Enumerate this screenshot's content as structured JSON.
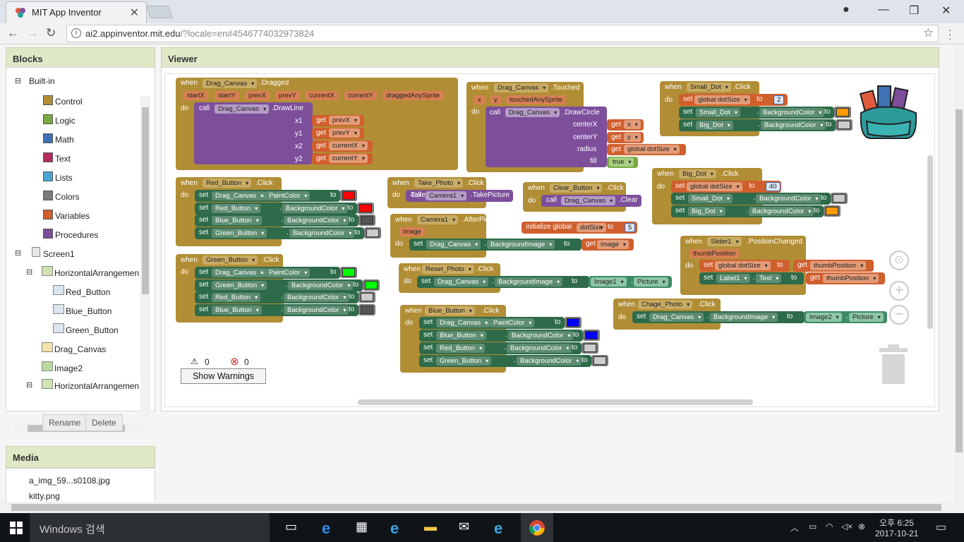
{
  "browser": {
    "tab_title": "MIT App Inventor",
    "tab_close": "✕",
    "url_host": "ai2.appinventor.mit.edu",
    "url_rest": "/?locale=en#4546774032973824",
    "window_minimize": "—",
    "window_restore": "❐",
    "window_close": "✕"
  },
  "blocks_panel": {
    "title": "Blocks",
    "builtin_label": "Built-in",
    "builtin": [
      {
        "label": "Control",
        "color": "#b18e35"
      },
      {
        "label": "Logic",
        "color": "#77ab41"
      },
      {
        "label": "Math",
        "color": "#3f71b5"
      },
      {
        "label": "Text",
        "color": "#b32d5e"
      },
      {
        "label": "Lists",
        "color": "#49a6d4"
      },
      {
        "label": "Colors",
        "color": "#7a7a7a"
      },
      {
        "label": "Variables",
        "color": "#d05f2e"
      },
      {
        "label": "Procedures",
        "color": "#7d4f9b"
      }
    ],
    "screen": "Screen1",
    "components": [
      "HorizontalArrangemen",
      "Red_Button",
      "Blue_Button",
      "Green_Button",
      "Drag_Canvas",
      "Image2",
      "HorizontalArrangemen"
    ],
    "rename": "Rename",
    "delete": "Delete"
  },
  "media_panel": {
    "title": "Media",
    "files": [
      "a_img_59...s0108.jpg",
      "kitty.png"
    ]
  },
  "viewer": {
    "title": "Viewer",
    "warnings_count": "0",
    "errors_count": "0",
    "show_warnings": "Show Warnings"
  },
  "blocks": {
    "when": "when",
    "do": "do",
    "set": "set",
    "get": "get",
    "to": "to",
    "call": "call",
    "dot": ".",
    "dragged": {
      "component": "Drag_Canvas",
      "event": ".Dragged",
      "params": [
        "startX",
        "startY",
        "prevX",
        "prevY",
        "currentX",
        "currentY",
        "draggedAnySprite"
      ],
      "method": ".DrawLine",
      "arg_labels": [
        "x1",
        "y1",
        "x2",
        "y2"
      ],
      "arg_values": [
        "prevX",
        "prevY",
        "currentX",
        "currentY"
      ]
    },
    "touched": {
      "component": "Drag_Canvas",
      "event": ".Touched",
      "params": [
        "x",
        "y",
        "touchedAnySprite"
      ],
      "method": ".DrawCircle",
      "arg_labels": [
        "centerX",
        "centerY",
        "radius",
        "fill"
      ],
      "arg_values": [
        "x",
        "y",
        "global dotSize",
        "true"
      ]
    },
    "small_dot": {
      "component": "Small_Dot",
      "event": ".Click",
      "var": "global dotSize",
      "value": "2",
      "rows": [
        {
          "comp": "Small_Dot",
          "prop": "BackgroundColor",
          "color": "#ff9900"
        },
        {
          "comp": "Big_Dot",
          "prop": "BackgroundColor",
          "color": "#cccccc"
        }
      ]
    },
    "big_dot": {
      "component": "Big_Dot",
      "event": ".Click",
      "var": "global dotSize",
      "value": "40",
      "rows": [
        {
          "comp": "Small_Dot",
          "prop": "BackgroundColor",
          "color": "#cccccc"
        },
        {
          "comp": "Big_Dot",
          "prop": "BackgroundColor",
          "color": "#ff9900"
        }
      ]
    },
    "red_button": {
      "component": "Red_Button",
      "event": ".Click",
      "rows": [
        {
          "comp": "Drag_Canvas",
          "prop": "PaintColor",
          "color": "#ff0000"
        },
        {
          "comp": "Red_Button",
          "prop": "BackgroundColor",
          "color": "#ff0000"
        },
        {
          "comp": "Blue_Button",
          "prop": "BackgroundColor",
          "color": "#555555"
        },
        {
          "comp": "Green_Button",
          "prop": "BackgroundColor",
          "color": "#cccccc"
        }
      ]
    },
    "green_button": {
      "component": "Green_Button",
      "event": ".Click",
      "rows": [
        {
          "comp": "Drag_Canvas",
          "prop": "PaintColor",
          "color": "#00ff00"
        },
        {
          "comp": "Green_Button",
          "prop": "BackgroundColor",
          "color": "#00ff00"
        },
        {
          "comp": "Red_Button",
          "prop": "BackgroundColor",
          "color": "#cccccc"
        },
        {
          "comp": "Blue_Button",
          "prop": "BackgroundColor",
          "color": "#555555"
        }
      ]
    },
    "blue_button": {
      "component": "Blue_Button",
      "event": ".Click",
      "rows": [
        {
          "comp": "Drag_Canvas",
          "prop": "PaintColor",
          "color": "#0000ff"
        },
        {
          "comp": "Blue_Button",
          "prop": "BackgroundColor",
          "color": "#0000ff"
        },
        {
          "comp": "Red_Button",
          "prop": "BackgroundColor",
          "color": "#cccccc"
        },
        {
          "comp": "Green_Button",
          "prop": "BackgroundColor",
          "color": "#cccccc"
        }
      ]
    },
    "take_photo": {
      "component": "Take_Photo",
      "event": ".Click",
      "target": "Camera1",
      "method": ".TakePicture"
    },
    "clear_button": {
      "component": "Clear_Button",
      "event": ".Click",
      "target": "Drag_Canvas",
      "method": ".Clear"
    },
    "init_global": {
      "label": "initialize global",
      "name": "dotSize",
      "value": "5"
    },
    "camera_after": {
      "component": "Camera1",
      "event": ".AfterPicture",
      "param": "image",
      "comp": "Drag_Canvas",
      "prop": "BackgroundImage",
      "value": "image"
    },
    "reset_photo": {
      "component": "Reset_Photo",
      "event": ".Click",
      "comp": "Drag_Canvas",
      "prop": "BackgroundImage",
      "src_comp": "Image1",
      "src_prop": "Picture"
    },
    "slider": {
      "component": "Slider1",
      "event": ".PositionChanged",
      "param": "thumbPosition",
      "var": "global dotSize",
      "value": "thumbPosition",
      "comp": "Label1",
      "prop": "Text",
      "value2": "thumbPosition"
    },
    "chage_photo": {
      "component": "Chage_Photo",
      "event": ".Click",
      "comp": "Drag_Canvas",
      "prop": "BackgroundImage",
      "src_comp": "Image2",
      "src_prop": "Picture"
    }
  },
  "taskbar": {
    "search_placeholder": "Windows 검색",
    "time": "오후 6:25",
    "date": "2017-10-21"
  }
}
